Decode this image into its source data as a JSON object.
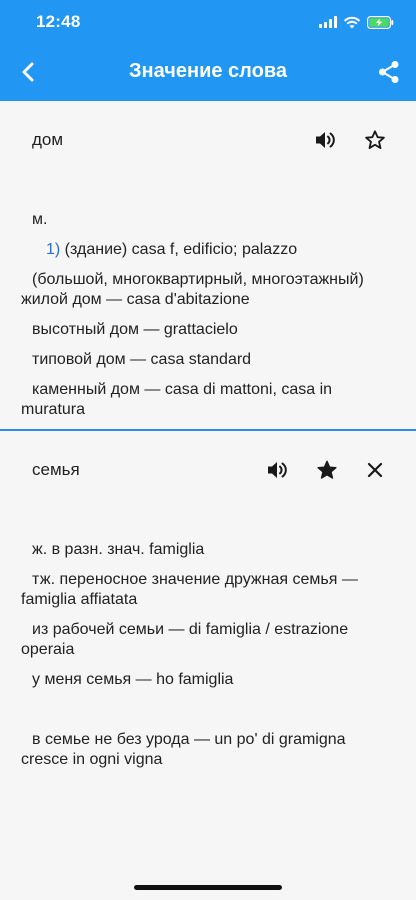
{
  "status_bar": {
    "time": "12:48"
  },
  "toolbar": {
    "title": "Значение слова",
    "back_icon": "chevron-left-icon",
    "share_icon": "share-icon"
  },
  "entries": [
    {
      "word": "дом",
      "favorite": false,
      "grammar": "м.",
      "sense_number": "1)",
      "sense_text": " (здание) casa f, edificio; palazzo",
      "lines": [
        "(большой, многоквартирный, многоэтажный) жилой дом — casa d'abitazione",
        "высотный дом — grattacielo",
        "типовой дом — casa standard",
        "каменный дом — casa di mattoni, casa in muratura"
      ]
    },
    {
      "word": "семья",
      "favorite": true,
      "lines": [
        "ж. в разн. знач. famiglia",
        "тж. переносное значение дружная семья — famiglia affiatata",
        "из рабочей семьи — di famiglia / estrazione operaia",
        "у меня семья — ho famiglia"
      ],
      "extra_line": "в семье не без урода — un po' di gramigna cresce in ogni vigna"
    }
  ],
  "colors": {
    "header": "#2196f3",
    "divider": "#2a8de6",
    "sense_number": "#2b6fd6",
    "background": "#f6f6f6"
  }
}
